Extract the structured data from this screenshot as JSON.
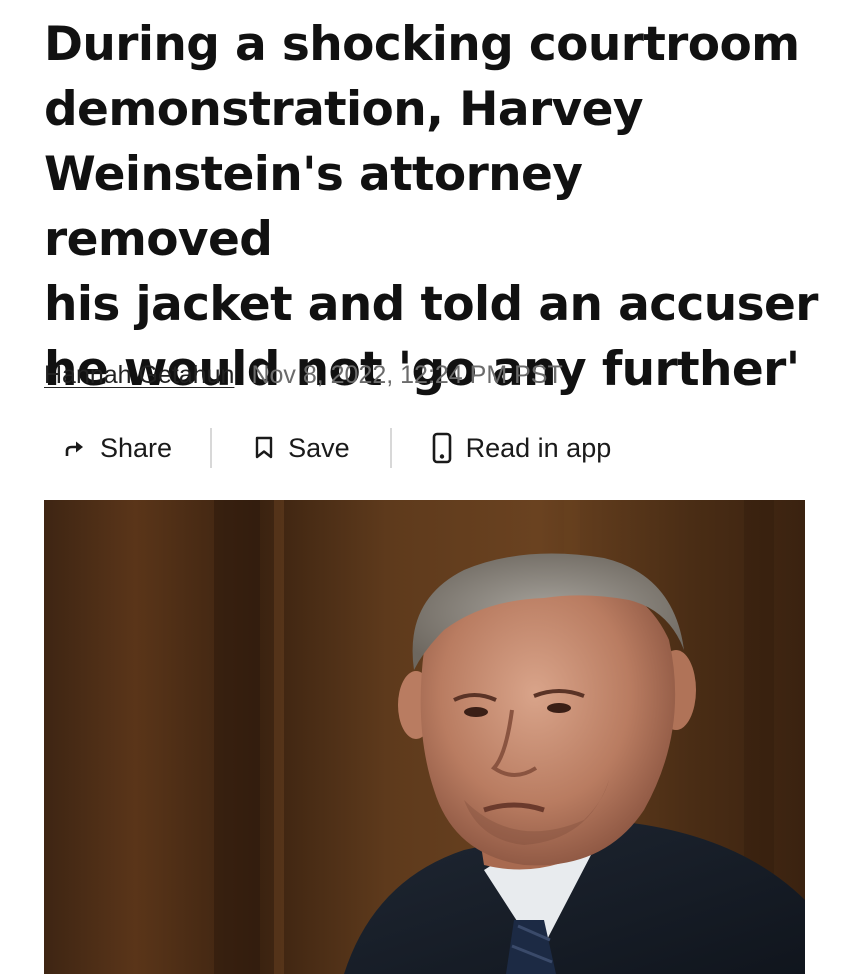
{
  "article": {
    "headline_lines": [
      "During a shocking courtroom",
      "demonstration, Harvey",
      "Weinstein's attorney removed",
      "his jacket and told an accuser",
      "he would not 'go any further'"
    ],
    "author": "Hannah Getahun",
    "timestamp": "Nov 8, 2022, 12:24 PM PST"
  },
  "actions": {
    "share": {
      "label": "Share",
      "icon": "share-arrow-icon"
    },
    "save": {
      "label": "Save",
      "icon": "bookmark-icon"
    },
    "read_in_app": {
      "label": "Read in app",
      "icon": "phone-icon"
    }
  },
  "colors": {
    "text": "#111111",
    "muted": "#6b6b6b",
    "divider": "#d8d8d8",
    "photo_background": "#4a2d15"
  }
}
